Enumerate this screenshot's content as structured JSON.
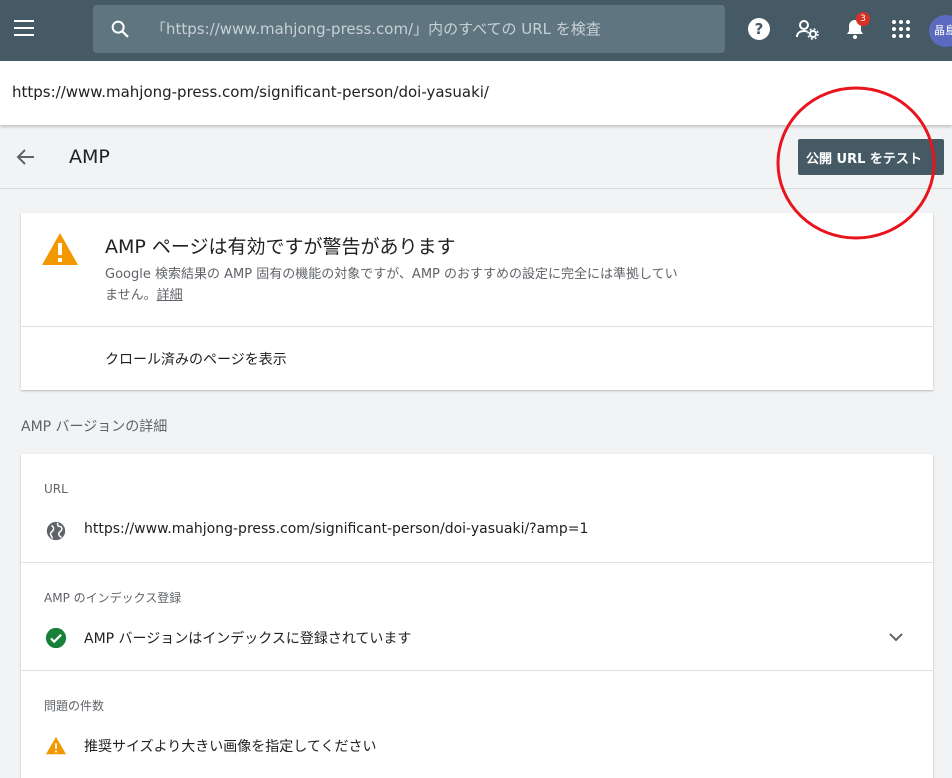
{
  "topbar": {
    "search_placeholder": "「https://www.mahjong-press.com/」内のすべての URL を検査",
    "notification_count": "3",
    "avatar_text": "晶島"
  },
  "inspected_url": "https://www.mahjong-press.com/significant-person/doi-yasuaki/",
  "header": {
    "title": "AMP",
    "test_live_url_label": "公開 URL をテスト"
  },
  "status": {
    "title": "AMP ページは有効ですが警告があります",
    "description": "Google 検索結果の AMP 固有の機能の対象ですが、AMP のおすすめの設定に完全には準拠していません。",
    "details_link": "詳細",
    "view_crawled_label": "クロール済みのページを表示"
  },
  "details": {
    "section_title": "AMP バージョンの詳細",
    "url_label": "URL",
    "amp_url": "https://www.mahjong-press.com/significant-person/doi-yasuaki/?amp=1",
    "indexing_label": "AMP のインデックス登録",
    "indexing_status": "AMP バージョンはインデックスに登録されています",
    "issues_label": "問題の件数",
    "issue_text": "推奨サイズより大きい画像を指定してください"
  },
  "colors": {
    "appbar": "#455a64",
    "warning": "#f29900",
    "success": "#188038",
    "annotation_circle": "#e8141e"
  }
}
